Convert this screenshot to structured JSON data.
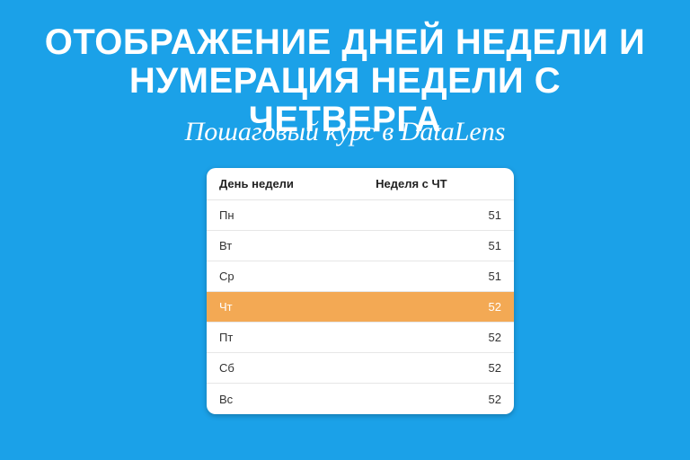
{
  "heading": "ОТОБРАЖЕНИЕ ДНЕЙ НЕДЕЛИ И НУМЕРАЦИЯ НЕДЕЛИ С ЧЕТВЕРГА",
  "subheading": "Пошаговый курс в DataLens",
  "table": {
    "headers": {
      "day": "День недели",
      "week": "Неделя с ЧТ"
    },
    "rows": [
      {
        "day": "Пн",
        "week": "51",
        "highlight": false
      },
      {
        "day": "Вт",
        "week": "51",
        "highlight": false
      },
      {
        "day": "Ср",
        "week": "51",
        "highlight": false
      },
      {
        "day": "Чт",
        "week": "52",
        "highlight": true
      },
      {
        "day": "Пт",
        "week": "52",
        "highlight": false
      },
      {
        "day": "Сб",
        "week": "52",
        "highlight": false
      },
      {
        "day": "Вс",
        "week": "52",
        "highlight": false
      }
    ]
  },
  "chart_data": {
    "type": "table",
    "title": "Отображение дней недели и нумерация недели с четверга",
    "columns": [
      "День недели",
      "Неделя с ЧТ"
    ],
    "rows": [
      [
        "Пн",
        51
      ],
      [
        "Вт",
        51
      ],
      [
        "Ср",
        51
      ],
      [
        "Чт",
        52
      ],
      [
        "Пт",
        52
      ],
      [
        "Сб",
        52
      ],
      [
        "Вс",
        52
      ]
    ],
    "highlight_row_index": 3
  }
}
